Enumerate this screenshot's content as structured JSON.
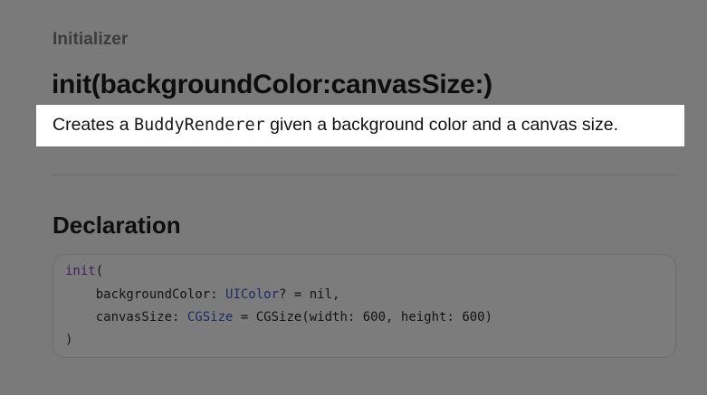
{
  "header": {
    "eyebrow": "Initializer",
    "title": "init(backgroundColor:canvasSize:)"
  },
  "abstract": {
    "prefix": "Creates a ",
    "code": "BuddyRenderer",
    "suffix": " given a background color and a canvas size."
  },
  "declaration": {
    "title": "Declaration",
    "lines": [
      {
        "keyword": "init",
        "rest": "("
      },
      {
        "indent": "    ",
        "label": "backgroundColor: ",
        "type": "UIColor",
        "rest": "? = nil,"
      },
      {
        "indent": "    ",
        "label": "canvasSize: ",
        "type": "CGSize",
        "rest": " = CGSize(width: 600, height: 600)"
      },
      {
        "rest": ")"
      }
    ]
  },
  "colors": {
    "overlay_background": "#7a7a7a",
    "highlight": "#ffffff",
    "keyword": "#3d1e58",
    "type": "#1d2a66"
  }
}
